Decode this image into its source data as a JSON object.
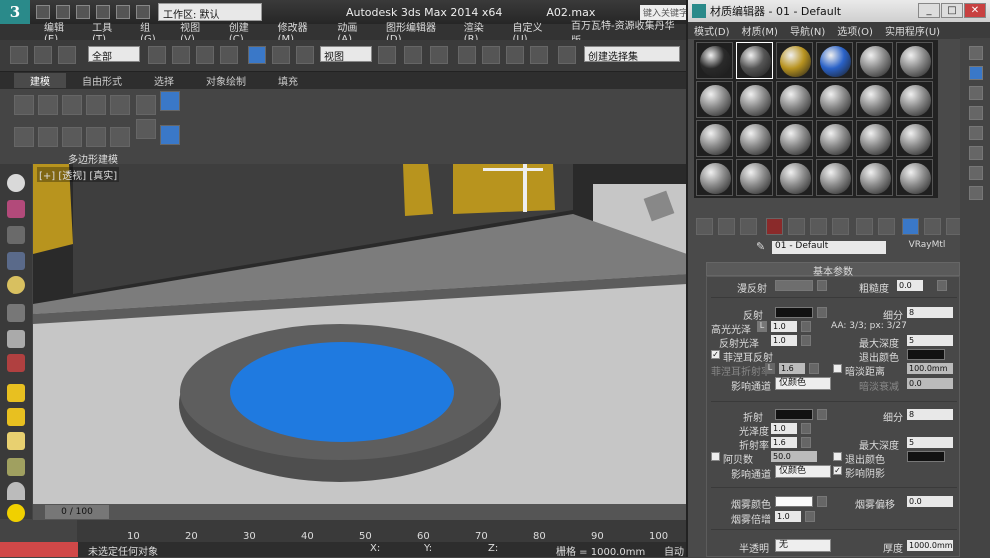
{
  "main": {
    "title": "Autodesk 3ds Max  2014 x64",
    "file": "A02.max",
    "workspace": "工作区: 默认",
    "search_placeholder": "键入关键字",
    "menu": [
      "编辑(E)",
      "工具(T)",
      "组(G)",
      "视图(V)",
      "创建(C)",
      "修改器(M)",
      "动画(A)",
      "图形编辑器(D)",
      "渲染(R)",
      "自定义(U)",
      "百万瓦特-资源收集丹华版"
    ],
    "selection_filter": "全部",
    "ref_coord": "视图",
    "named_sel": "创建选择集",
    "ribbon_tabs": [
      "建模",
      "自由形式",
      "选择",
      "对象绘制",
      "填充"
    ],
    "ribbon_group": "多边形建模",
    "viewport_label": "[+] [透视] [真实]",
    "frame": "0 / 100",
    "ruler_ticks": [
      "10",
      "20",
      "30",
      "40",
      "50",
      "60",
      "70",
      "80",
      "90",
      "100"
    ],
    "status": "未选定任何对象",
    "x_label": "X:",
    "y_label": "Y:",
    "z_label": "Z:",
    "grid": "栅格 = 1000.0mm",
    "auto": "自动"
  },
  "material_editor": {
    "title": "材质编辑器 - 01 - Default",
    "menu": [
      "模式(D)",
      "材质(M)",
      "导航(N)",
      "选项(O)",
      "实用程序(U)"
    ],
    "material_name": "01 - Default",
    "material_type": "VRayMtl",
    "rollout_title": "基本参数",
    "slot_colors": [
      "#2a2a2a",
      "#555555",
      "#b89320",
      "#2a62c8",
      "#8a8a8a",
      "#8a8a8a"
    ],
    "diffuse": {
      "label": "漫反射",
      "roughness_label": "粗糙度",
      "roughness": "0.0",
      "color": "#6e6e6e"
    },
    "reflect": {
      "label": "反射",
      "color": "#111111",
      "subdivs_label": "细分",
      "subdivs": "8",
      "hilight_label": "高光光泽",
      "hilight_lock": "L",
      "hilight": "1.0",
      "aa_label": "AA: 3/3; px: 3/27",
      "gloss_label": "反射光泽",
      "gloss": "1.0",
      "maxdepth_label": "最大深度",
      "maxdepth": "5",
      "fresnel_label": "菲涅耳反射",
      "fresnel_check": "✓",
      "exit_label": "退出颜色",
      "fresnel_ior_label": "菲涅耳折射率",
      "fresnel_ior_lock": "L",
      "fresnel_ior": "1.6",
      "dim_label": "暗淡距离",
      "dim_distance": "100.0mm",
      "affect_label": "影响通道",
      "affect": "仅颜色",
      "dimfall_label": "暗淡衰减",
      "dimfall": "0.0"
    },
    "refract": {
      "label": "折射",
      "color": "#111111",
      "subdivs_label": "细分",
      "subdivs": "8",
      "gloss_label": "光泽度",
      "gloss": "1.0",
      "ior_label": "折射率",
      "ior": "1.6",
      "maxdepth_label": "最大深度",
      "maxdepth": "5",
      "abbe_label": "阿贝数",
      "abbe": "50.0",
      "exit_label": "退出颜色",
      "affect_label": "影响通道",
      "affect": "仅颜色",
      "shadows_label": "影响阴影",
      "shadows_check": "✓"
    },
    "fog": {
      "color_label": "烟雾颜色",
      "bias_label": "烟雾偏移",
      "bias": "0.0",
      "mult_label": "烟雾倍增",
      "mult": "1.0"
    },
    "translucency": {
      "label": "半透明",
      "value": "无",
      "thick_label": "厚度",
      "thick": "1000.0mm"
    }
  }
}
